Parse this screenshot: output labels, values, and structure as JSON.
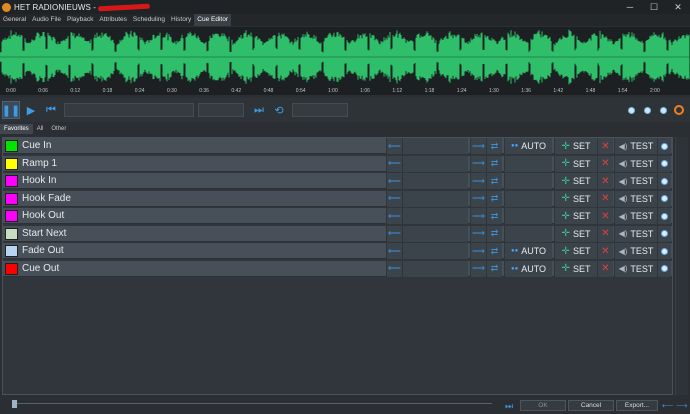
{
  "window": {
    "title": "HET RADIONIEUWS -"
  },
  "menu_tabs": [
    "General",
    "Audio File",
    "Playback",
    "Attributes",
    "Scheduling",
    "History",
    "Cue Editor"
  ],
  "active_menu_tab": "Cue Editor",
  "timeline_labels": [
    "0:00",
    "0:06",
    "0:12",
    "0:18",
    "0:24",
    "0:30",
    "0:36",
    "0:42",
    "0:48",
    "0:54",
    "1:00",
    "1:06",
    "1:12",
    "1:18",
    "1:24",
    "1:30",
    "1:36",
    "1:42",
    "1:48",
    "1:54",
    "2:00"
  ],
  "sub_tabs": [
    "Favorites",
    "All",
    "Other"
  ],
  "active_sub_tab": "Favorites",
  "cues": [
    {
      "name": "Cue In",
      "color": "#00e400",
      "auto": true,
      "set": "SET",
      "test": "TEST"
    },
    {
      "name": "Ramp 1",
      "color": "#ffff00",
      "auto": false,
      "set": "SET",
      "test": "TEST"
    },
    {
      "name": "Hook In",
      "color": "#ff00ff",
      "auto": false,
      "set": "SET",
      "test": "TEST"
    },
    {
      "name": "Hook Fade",
      "color": "#ff00ff",
      "auto": false,
      "set": "SET",
      "test": "TEST"
    },
    {
      "name": "Hook Out",
      "color": "#ff00ff",
      "auto": false,
      "set": "SET",
      "test": "TEST"
    },
    {
      "name": "Start Next",
      "color": "#c8dcc0",
      "auto": false,
      "set": "SET",
      "test": "TEST"
    },
    {
      "name": "Fade Out",
      "color": "#b8d4f0",
      "auto": true,
      "set": "SET",
      "test": "TEST"
    },
    {
      "name": "Cue Out",
      "color": "#ff0000",
      "auto": true,
      "set": "SET",
      "test": "TEST"
    }
  ],
  "auto_label": "AUTO",
  "bottom": {
    "ok": "OK",
    "cancel": "Cancel",
    "export": "Export..."
  },
  "colors": {
    "waveform": "#2fbf6a",
    "accent": "#3e8fd8",
    "background": "#2b2f33"
  }
}
